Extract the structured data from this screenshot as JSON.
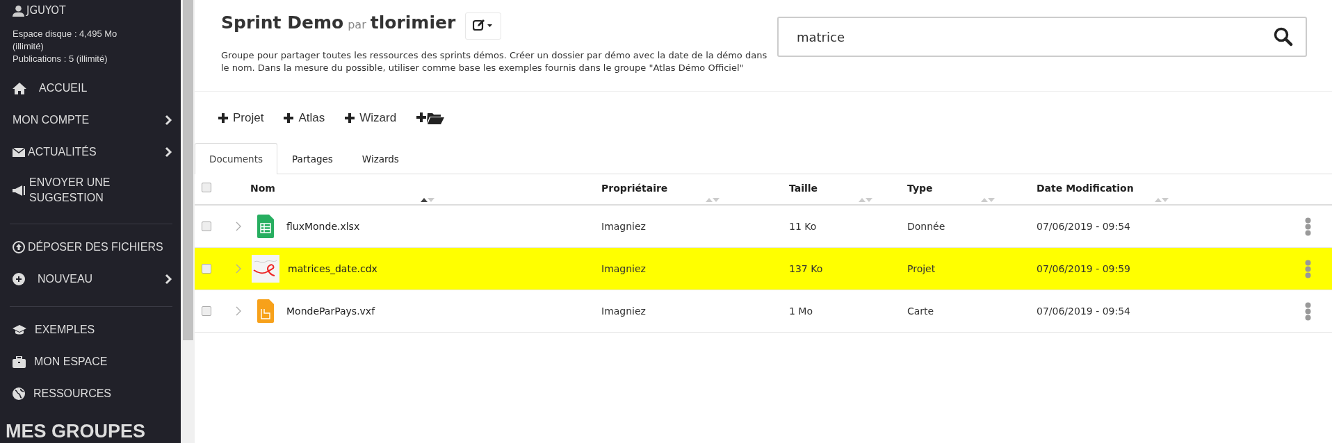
{
  "sidebar": {
    "user": "JGUYOT",
    "quota_lines": [
      "Espace disque : 4,495 Mo",
      "(illimité)",
      "Publications : 5 (illimité)"
    ],
    "sections": [
      [
        {
          "label": "ACCUEIL",
          "kind": "home",
          "chevron": false
        },
        {
          "label": "MON COMPTE",
          "kind": "plain",
          "chevron": true
        },
        {
          "label": "ACTUALITÉS",
          "kind": "news",
          "chevron": true
        },
        {
          "label": "ENVOYER UNE SUGGESTION",
          "kind": "suggest",
          "chevron": false
        }
      ],
      [
        {
          "label": "DÉPOSER DES FICHIERS",
          "kind": "upload",
          "chevron": false
        },
        {
          "label": "NOUVEAU",
          "kind": "new",
          "chevron": true
        }
      ],
      [
        {
          "label": "EXEMPLES",
          "kind": "examples",
          "chevron": false
        },
        {
          "label": "MON ESPACE",
          "kind": "space",
          "chevron": false
        },
        {
          "label": "RESSOURCES",
          "kind": "resources",
          "chevron": false
        }
      ]
    ],
    "groups_heading": "MES GROUPES"
  },
  "header": {
    "title": "Sprint Demo",
    "by": "par",
    "owner": "tlorimier",
    "description": "Groupe pour partager toutes les ressources des sprints démos. Créer un dossier par démo avec la date de la démo dans le nom. Dans la mesure du possible, utiliser comme base les exemples fournis dans le groupe \"Atlas Démo Officiel\""
  },
  "search": {
    "value": "matrice"
  },
  "toolbar": [
    {
      "kind": "add",
      "label": "Projet"
    },
    {
      "kind": "add",
      "label": "Atlas"
    },
    {
      "kind": "add",
      "label": "Wizard"
    },
    {
      "kind": "folder"
    }
  ],
  "tabs": [
    {
      "label": "Documents",
      "selected": true
    },
    {
      "label": "Partages",
      "selected": false
    },
    {
      "label": "Wizards",
      "selected": false
    }
  ],
  "table": {
    "select_all": false,
    "columns": [
      {
        "label": "Nom",
        "sorted": true
      },
      {
        "label": "Propriétaire",
        "sorted": false
      },
      {
        "label": "Taille",
        "sorted": false
      },
      {
        "label": "Type",
        "sorted": false
      },
      {
        "label": "Date Modification",
        "sorted": false
      }
    ],
    "rows": [
      {
        "checked": false,
        "selected": false,
        "kind": "sheet",
        "name": "fluxMonde.xlsx",
        "owner": "Imagniez",
        "size": "11 Ko",
        "type": "Donnée",
        "date": "07/06/2019 - 09:54"
      },
      {
        "checked": false,
        "selected": true,
        "kind": "project",
        "name": "matrices_date.cdx",
        "owner": "Imagniez",
        "size": "137 Ko",
        "type": "Projet",
        "date": "07/06/2019 - 09:59"
      },
      {
        "checked": false,
        "selected": false,
        "kind": "map",
        "name": "MondeParPays.vxf",
        "owner": "Imagniez",
        "size": "1 Mo",
        "type": "Carte",
        "date": "07/06/2019 - 09:54"
      }
    ]
  }
}
